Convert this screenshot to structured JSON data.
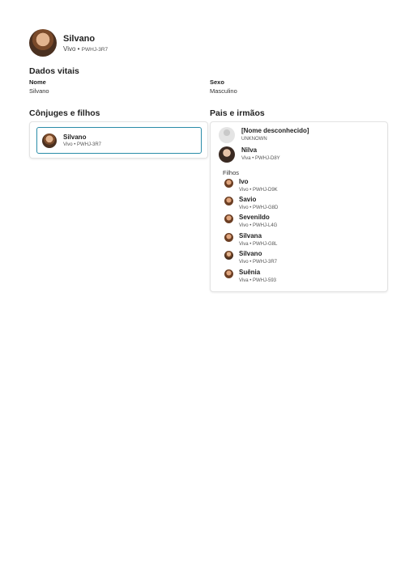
{
  "person": {
    "name": "Silvano",
    "status": "Vivo",
    "pid": "PWHJ-3R7"
  },
  "vitals": {
    "title": "Dados vitais",
    "name_label": "Nome",
    "name_value": "Silvano",
    "sex_label": "Sexo",
    "sex_value": "Masculino"
  },
  "spouses": {
    "title": "Cônjuges e filhos",
    "person": {
      "name": "Silvano",
      "meta": "Vivo • PWHJ-3R7"
    }
  },
  "parents": {
    "title": "Pais e irmãos",
    "father": {
      "name": "[Nome desconhecido]",
      "meta": "UNKNOWN"
    },
    "mother": {
      "name": "Nilva",
      "meta": "Viva • PWHJ-D8Y"
    },
    "children_label": "Filhos",
    "children": [
      {
        "name": "Ivo",
        "meta": "Vivo • PWHJ-D9K"
      },
      {
        "name": "Savio",
        "meta": "Vivo • PWHJ-G8D"
      },
      {
        "name": "Sevenildo",
        "meta": "Vivo • PWHJ-L4G"
      },
      {
        "name": "Silvana",
        "meta": "Viva • PWHJ-G8L"
      },
      {
        "name": "Silvano",
        "meta": "Vivo • PWHJ-3R7"
      },
      {
        "name": "Suênia",
        "meta": "Viva • PWHJ-593"
      }
    ]
  }
}
